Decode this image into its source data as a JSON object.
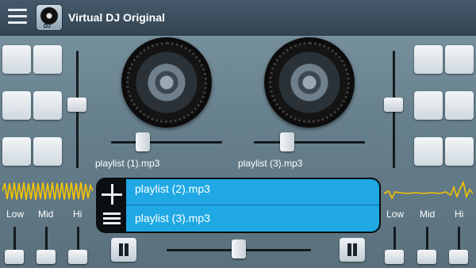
{
  "app": {
    "title": "Virtual DJ Original",
    "icon_label": "DJ"
  },
  "left_deck": {
    "track": "playlist (1).mp3",
    "eq_labels": [
      "Low",
      "Mid",
      "Hi"
    ]
  },
  "right_deck": {
    "track": "playlist (3).mp3",
    "eq_labels": [
      "Low",
      "Mid",
      "Hi"
    ]
  },
  "playlist": {
    "items": [
      "playlist (2).mp3",
      "playlist (3).mp3"
    ]
  },
  "colors": {
    "accent": "#1fa8e4",
    "waveform_left": "#f5c400",
    "waveform_right": "#f5c400"
  },
  "icons": {
    "menu": "hamburger-menu-icon",
    "add": "plus-icon",
    "list": "list-icon",
    "pause": "pause-icon"
  }
}
